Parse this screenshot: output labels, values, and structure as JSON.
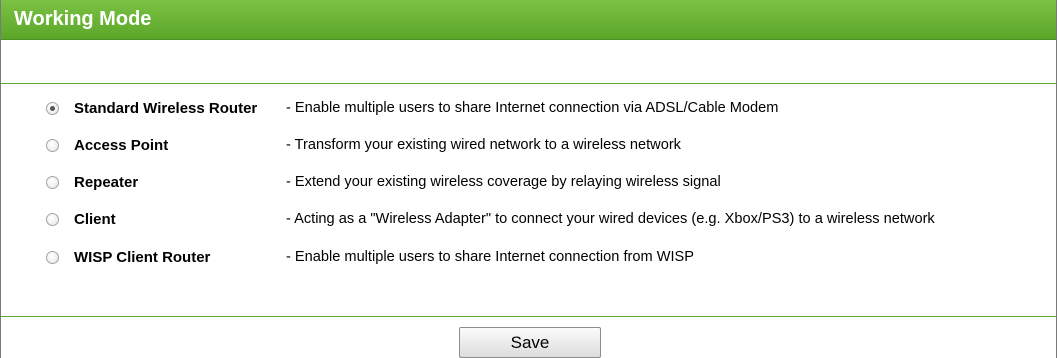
{
  "header": {
    "title": "Working Mode"
  },
  "options": [
    {
      "name": "Standard Wireless Router",
      "description": "- Enable multiple users to share Internet connection via ADSL/Cable Modem",
      "selected": true
    },
    {
      "name": "Access Point",
      "description": "- Transform your existing wired network to a wireless network",
      "selected": false
    },
    {
      "name": "Repeater",
      "description": "- Extend your existing wireless coverage by relaying wireless signal",
      "selected": false
    },
    {
      "name": "Client",
      "description": "- Acting as a \"Wireless Adapter\" to connect your wired devices (e.g. Xbox/PS3) to a wireless network",
      "selected": false
    },
    {
      "name": "WISP Client Router",
      "description": "- Enable multiple users to share Internet connection from WISP",
      "selected": false
    }
  ],
  "actions": {
    "save_label": "Save"
  },
  "colors": {
    "header": "#6ab536",
    "rule": "#5aa62c"
  }
}
